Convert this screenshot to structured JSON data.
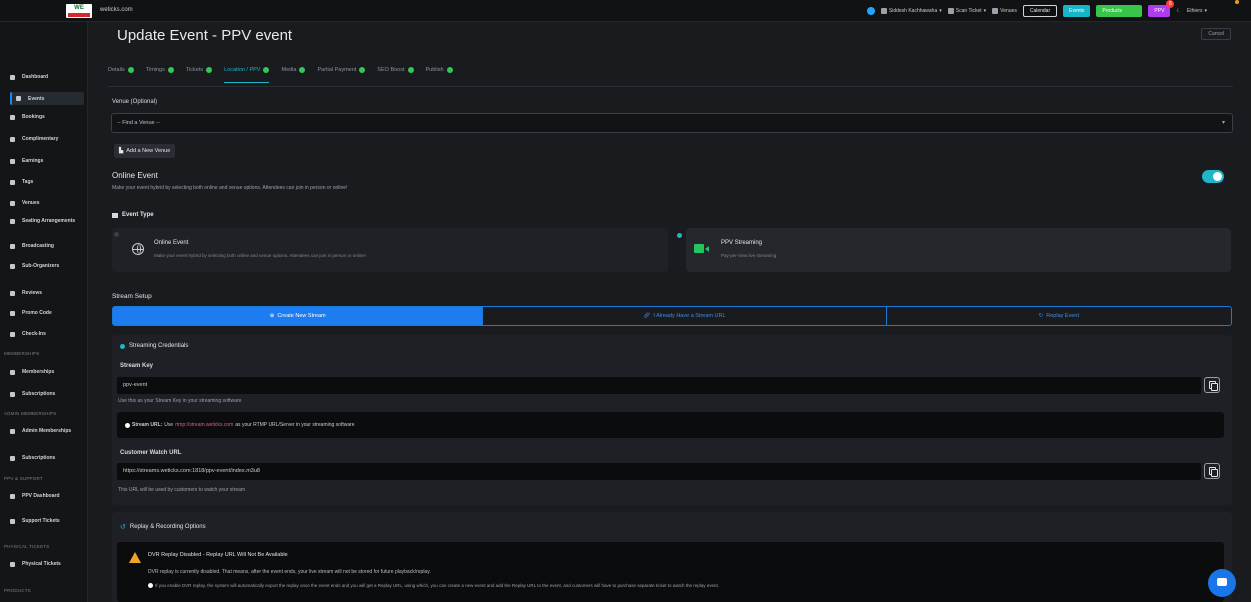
{
  "brand": {
    "logo_text": "WE",
    "domain": "weticks.com"
  },
  "topbar": {
    "user": "Siddesh Kachhawaha",
    "scan": "Scan Ticket",
    "venues": "Venues",
    "calendar": "Calendar",
    "events": "Events",
    "products": "Products",
    "ppv": "PPV",
    "ppv_badge": "6",
    "more": "Ethiers"
  },
  "sidebar": {
    "items": [
      {
        "label": "Dashboard"
      },
      {
        "label": "Events"
      },
      {
        "label": "Bookings"
      },
      {
        "label": "Complimentary"
      },
      {
        "label": "Earnings"
      },
      {
        "label": "Tags"
      },
      {
        "label": "Venues"
      },
      {
        "label": "Seating Arrangements"
      },
      {
        "label": "Broadcasting"
      },
      {
        "label": "Sub-Organizers"
      },
      {
        "label": "Reviews"
      },
      {
        "label": "Promo Code"
      },
      {
        "label": "Check-Ins"
      }
    ],
    "memberships_header": "MEMBERSHIPS",
    "memberships": [
      {
        "label": "Memberships"
      },
      {
        "label": "Subscriptions"
      }
    ],
    "admin_header": "ADMIN MEMBERSHIPS",
    "admin": [
      {
        "label": "Admin Memberships"
      },
      {
        "label": "Subscriptions"
      }
    ],
    "ppv_header": "PPV & SUPPORT",
    "ppv": [
      {
        "label": "PPV Dashboard"
      },
      {
        "label": "Support Tickets"
      }
    ],
    "physical_header": "PHYSICAL TICKETS",
    "physical": [
      {
        "label": "Physical Tickets"
      }
    ],
    "products_header": "PRODUCTS"
  },
  "page": {
    "title": "Update Event - PPV event",
    "cancel": "Cancel",
    "tabs": [
      {
        "label": "Details"
      },
      {
        "label": "Timings"
      },
      {
        "label": "Tickets"
      },
      {
        "label": "Location / PPV"
      },
      {
        "label": "Media"
      },
      {
        "label": "Partial Payment"
      },
      {
        "label": "SEO Boost"
      },
      {
        "label": "Publish"
      }
    ]
  },
  "venue": {
    "label": "Venue (Optional)",
    "select_value": "-- Find a Venue --",
    "add_button": "Add a New Venue"
  },
  "online": {
    "title": "Online Event",
    "desc": "Make your event hybrid by selecting both online and venue options. Attendees can join in person or online!",
    "enabled": true
  },
  "event_type": {
    "heading": "Event Type",
    "options": [
      {
        "title": "Online Event",
        "desc": "Make your event hybrid by selecting both online and venue options. Attendees can join in person or online!"
      },
      {
        "title": "PPV Streaming",
        "desc": "Pay-per-view live streaming"
      }
    ]
  },
  "stream_setup": {
    "heading": "Stream Setup",
    "buttons": [
      "Create New Stream",
      "I Already Have a Stream URL",
      "Replay Event"
    ]
  },
  "credentials": {
    "heading": "Streaming Credentials",
    "stream_key_label": "Stream Key",
    "stream_key": "ppv-event",
    "stream_key_hint": "Use this as your Stream Key in your streaming software",
    "stream_url_bold": "Stream URL:",
    "stream_url_pre": "Use",
    "stream_url_code": "rtmp://stream.weticks.com",
    "stream_url_post": "as your RTMP URL/Server in your streaming software",
    "watch_label": "Customer Watch URL",
    "watch_url": "https://streams.weticks.com:1818/ppv-event/index.m3u8",
    "watch_hint": "This URL will be used by customers to watch your stream"
  },
  "replay": {
    "heading": "Replay & Recording Options",
    "warn_title": "DVR Replay Disabled - Replay URL Will Not Be Available",
    "warn_text": "DVR replay is currently disabled. That means, after the event ends, your live stream will not be stored for future playback/replay.",
    "warn_note": "If you enable DVR replay, the system will automatically export the replay once the event ends and you will get a Replay URL, using which, you can create a new event and add the Replay URL to the event, and customers will have to purchase separate ticket to watch the replay event."
  },
  "colors": {
    "accent": "#1fb6c7",
    "primary": "#1c7cf0",
    "success": "#34c659",
    "warning": "#f0a42a",
    "ppv": "#b03cf2"
  }
}
